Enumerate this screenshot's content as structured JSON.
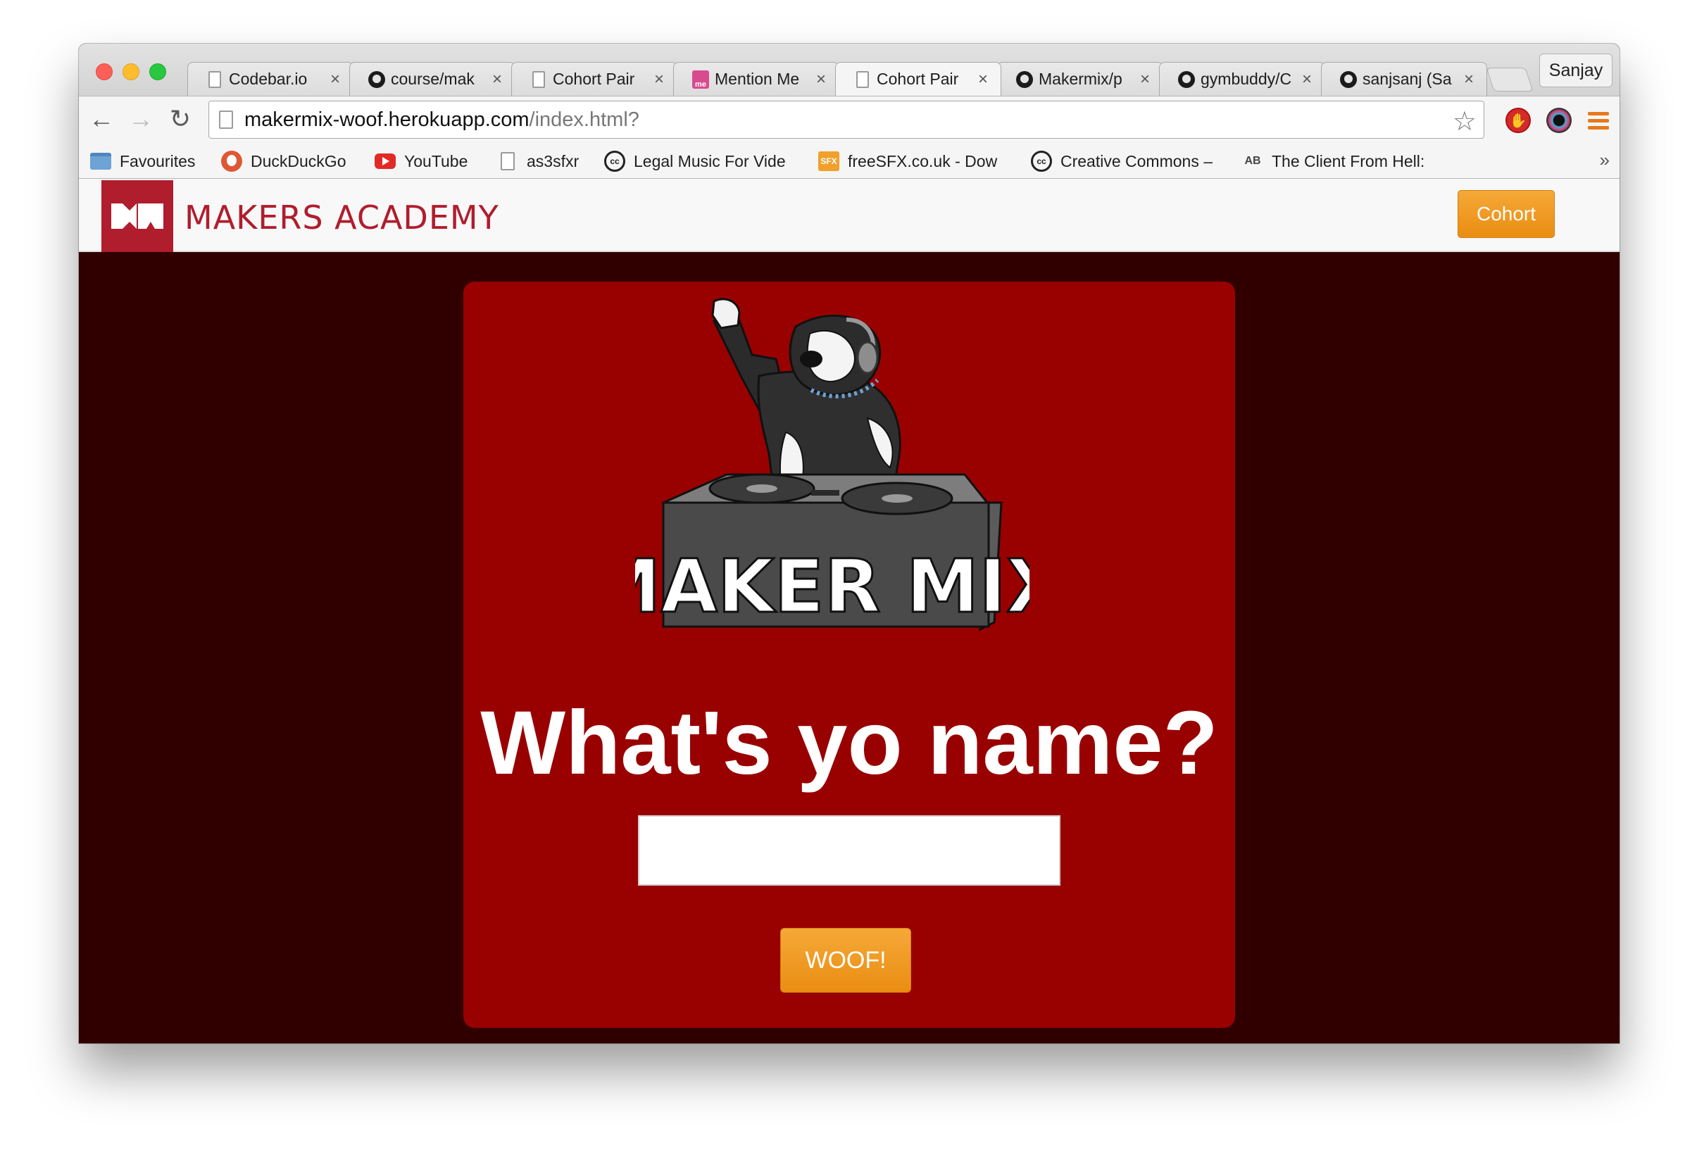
{
  "browser": {
    "tabs": [
      {
        "title": "Codebar.io",
        "icon": "document-icon"
      },
      {
        "title": "course/mak",
        "icon": "github-icon"
      },
      {
        "title": "Cohort Pair",
        "icon": "document-icon"
      },
      {
        "title": "Mention Me",
        "icon": "mention-me-icon"
      },
      {
        "title": "Cohort Pair",
        "icon": "document-icon",
        "active": true
      },
      {
        "title": "Makermix/p",
        "icon": "github-icon"
      },
      {
        "title": "gymbuddy/C",
        "icon": "github-icon"
      },
      {
        "title": "sanjsanj (Sa",
        "icon": "github-icon"
      }
    ],
    "profile_name": "Sanjay",
    "url_host": "makermix-woof.herokuapp.com",
    "url_path": "/index.html?",
    "bookmarks": [
      {
        "label": "Favourites",
        "icon": "folder-icon"
      },
      {
        "label": "DuckDuckGo",
        "icon": "duckduckgo-icon"
      },
      {
        "label": "YouTube",
        "icon": "youtube-icon"
      },
      {
        "label": "as3sfxr",
        "icon": "document-icon"
      },
      {
        "label": "Legal Music For Vide",
        "icon": "creative-commons-icon"
      },
      {
        "label": "freeSFX.co.uk - Dow",
        "icon": "freesfx-icon"
      },
      {
        "label": "Creative Commons –",
        "icon": "creative-commons-icon"
      },
      {
        "label": "The Client From Hell:",
        "icon": "spellcheck-icon"
      }
    ],
    "bookmarks_overflow": "»"
  },
  "site": {
    "brand": "MAKERS ACADEMY",
    "nav_button": "Cohort",
    "logo_text": "MAKER MIX",
    "heading": "What's yo name?",
    "name_input_value": "",
    "submit_label": "WOOF!"
  },
  "colors": {
    "page_bg": "#300000",
    "card_bg": "#990000",
    "brand_red": "#b01d2d",
    "button_orange": "#f0a030"
  }
}
